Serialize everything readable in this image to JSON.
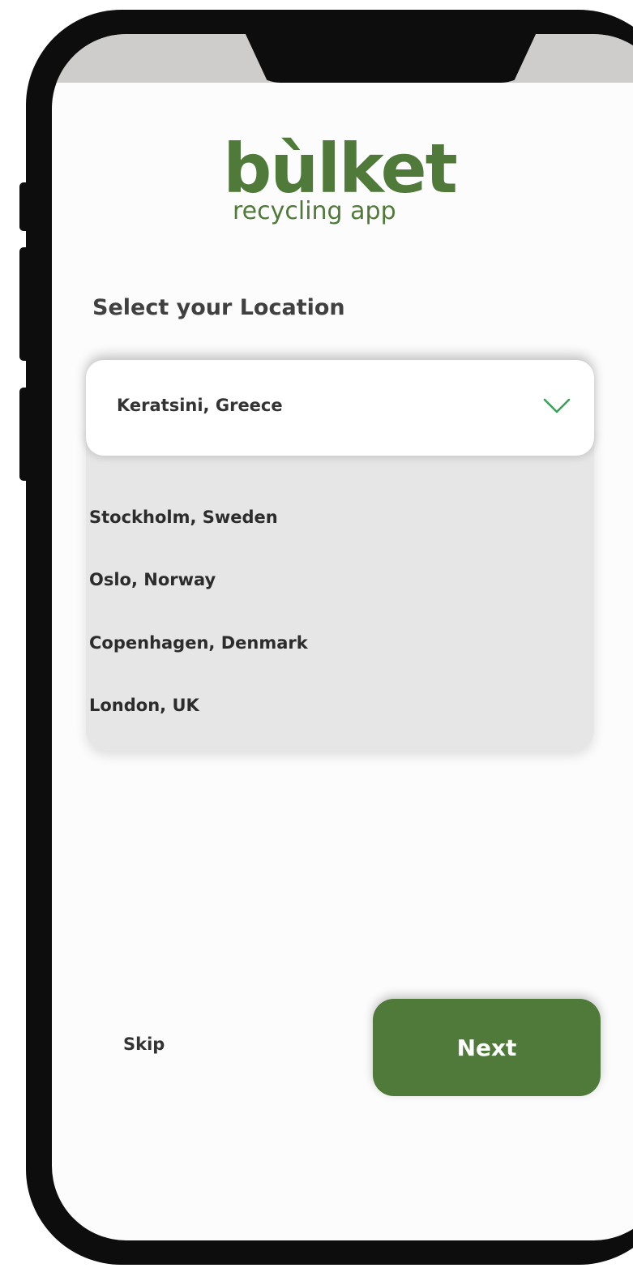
{
  "app": {
    "logo_text": "bùlket",
    "logo_subtitle": "recycling app"
  },
  "location": {
    "title": "Select your Location",
    "selected": "Keratsini, Greece",
    "options": [
      "Stockholm, Sweden",
      "Oslo, Norway",
      "Copenhagen, Denmark",
      "London, UK"
    ]
  },
  "actions": {
    "skip_label": "Skip",
    "next_label": "Next"
  },
  "icons": {
    "dropdown": "chevron-down-icon"
  },
  "colors": {
    "brand_green": "#4f7a3a",
    "chevron_green": "#3aa05a",
    "status_bar": "#cecdcb",
    "list_background": "#e6e6e6"
  }
}
